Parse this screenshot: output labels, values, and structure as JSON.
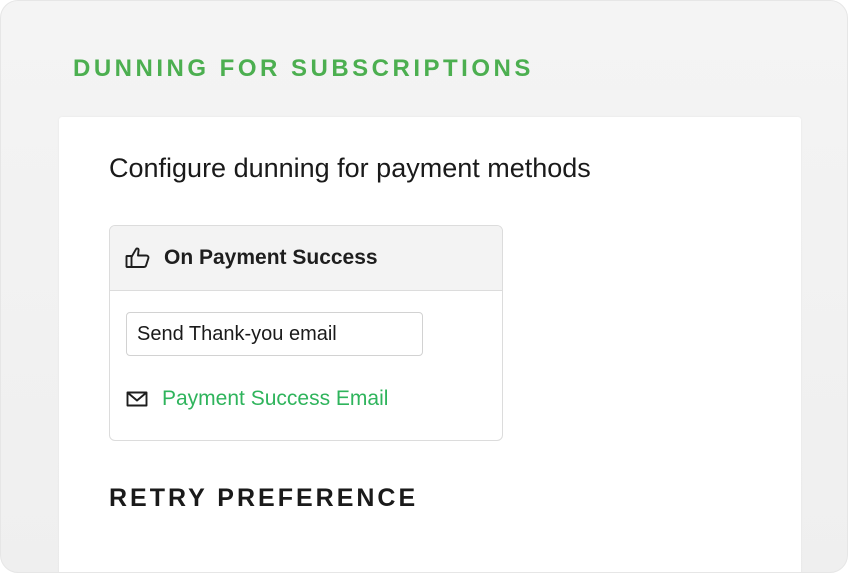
{
  "section": {
    "heading": "DUNNING FOR SUBSCRIPTIONS"
  },
  "panel": {
    "title": "Configure dunning for payment methods",
    "card": {
      "header_label": "On Payment Success",
      "header_icon": "thumbs-up-icon",
      "action_value": "Send Thank-you email",
      "email_link_label": "Payment Success Email",
      "email_icon": "mail-icon"
    },
    "retry_heading": "RETRY PREFERENCE"
  },
  "colors": {
    "heading_green": "#4caf50",
    "link_green": "#2fb45c",
    "text_dark": "#1a1a1a",
    "card_header_bg": "#f3f3f3"
  }
}
